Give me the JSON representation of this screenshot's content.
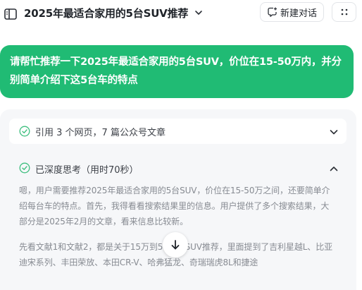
{
  "header": {
    "conversation_title": "2025年最适合家用的5台SUV推荐",
    "new_chat_label": "新建对话",
    "icons": [
      "sidebar-toggle-icon",
      "chevron-down-icon",
      "new-chat-icon",
      "more-dots-icon"
    ]
  },
  "user_message": {
    "text": "请帮忙推荐一下2025年最适合家用的5台SUV，价位在15-50万内，并分别简单介绍下这5台车的特点",
    "background_color": "#20bb74"
  },
  "references": {
    "label": "引用 3 个网页，7 篇公众号文章",
    "expanded": false
  },
  "thinking": {
    "label": "已深度思考（用时70秒）",
    "expanded": true,
    "paragraphs": [
      "嗯，用户需要推荐2025年最适合家用的5台SUV，价位在15-50万之间，还要简单介绍每台车的特点。首先，我得看看搜索结果里的信息。用户提供了多个搜索结果，大部分是2025年2月的文章，看来信息比较新。",
      "先看文献1和文献2，都是关于15万到50万的SUV推荐，里面提到了吉利星越L、比亚迪宋系列、丰田荣放、本田CR-V、哈弗猛龙、奇瑞瑞虎8L和捷途"
    ]
  },
  "colors": {
    "accent_green": "#20bb74",
    "check_green": "#3fbf7f",
    "panel_bg": "#f6f7f9",
    "muted_text": "#878b92"
  }
}
